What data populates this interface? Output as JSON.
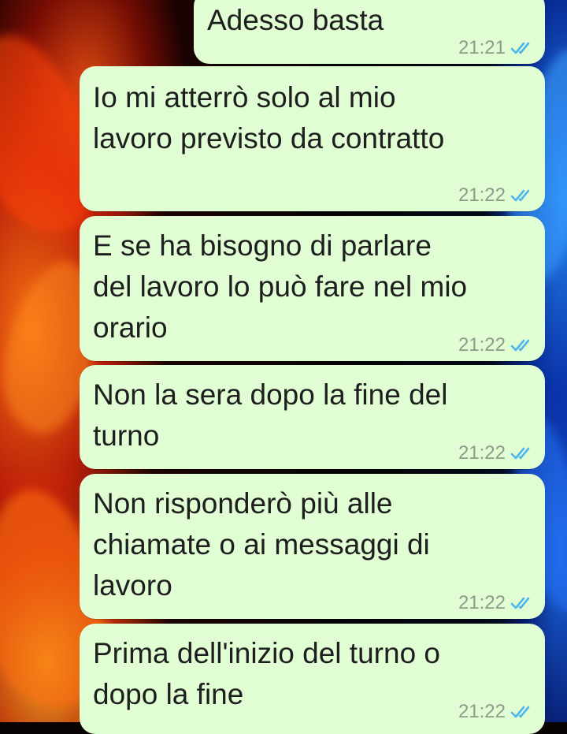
{
  "messages": [
    {
      "text": "Adesso basta",
      "time": "21:21",
      "status": "read",
      "icon": "double-check-icon"
    },
    {
      "text": "Io mi atterrò solo al mio\nlavoro previsto da contratto",
      "time": "21:22",
      "status": "read",
      "icon": "double-check-icon"
    },
    {
      "text": "E se ha bisogno di parlare\ndel lavoro lo può fare nel mio\norario",
      "time": "21:22",
      "status": "read",
      "icon": "double-check-icon"
    },
    {
      "text": "Non la sera dopo la fine del\nturno",
      "time": "21:22",
      "status": "read",
      "icon": "double-check-icon"
    },
    {
      "text": "Non risponderò più alle\nchiamate o ai messaggi di\nlavoro",
      "time": "21:22",
      "status": "read",
      "icon": "double-check-icon"
    },
    {
      "text": "Prima dell'inizio del turno o\ndopo la fine",
      "time": "21:22",
      "status": "read",
      "icon": "double-check-icon"
    }
  ],
  "colors": {
    "bubble": "#e1fdd3",
    "text": "#1e1e1e",
    "time": "#8f9a8a",
    "read_ticks": "#4fb6ec"
  }
}
